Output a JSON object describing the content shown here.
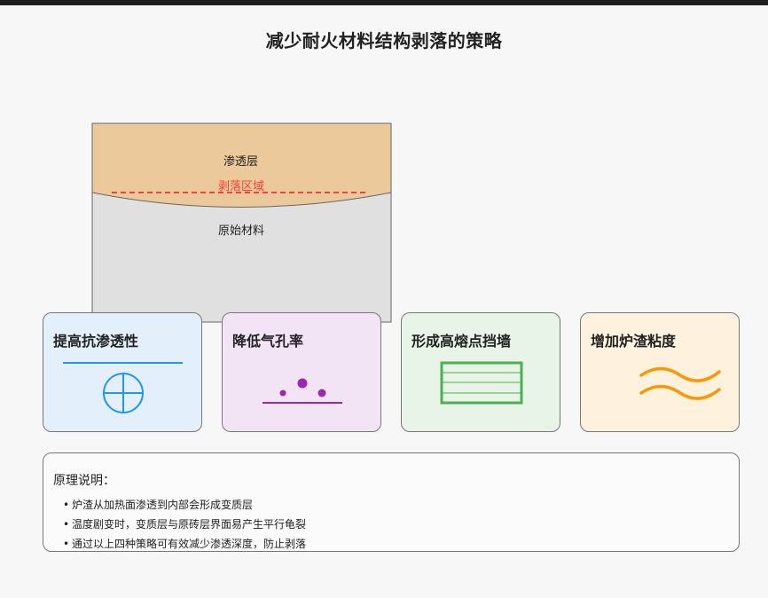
{
  "title": "减少耐火材料结构剥落的策略",
  "structure": {
    "penetration_layer": "渗透层",
    "spalling_zone": "剥落区域",
    "original_material": "原始材料"
  },
  "strategies": [
    {
      "title": "提高抗渗透性",
      "icon": "shield-plus-icon",
      "bg": "#e3f0fc",
      "accent": "#2196f3"
    },
    {
      "title": "降低气孔率",
      "icon": "pores-icon",
      "bg": "#f2e4f5",
      "accent": "#9c27b0"
    },
    {
      "title": "形成高熔点挡墙",
      "icon": "barrier-wall-icon",
      "bg": "#e7f4e7",
      "accent": "#4caf50"
    },
    {
      "title": "增加炉渣粘度",
      "icon": "viscous-waves-icon",
      "bg": "#fef2df",
      "accent": "#ff9800"
    }
  ],
  "explanation": {
    "title": "原理说明：",
    "items": [
      "炉渣从加热面渗透到内部会形成变质层",
      "温度剧变时，变质层与原砖层界面易产生平行龟裂",
      "通过以上四种策略可有效减少渗透深度，防止剥落"
    ]
  },
  "colors": {
    "penetration_fill": "#ecc99b",
    "original_fill": "#e0e0e0",
    "spalling_line": "#f44336"
  }
}
